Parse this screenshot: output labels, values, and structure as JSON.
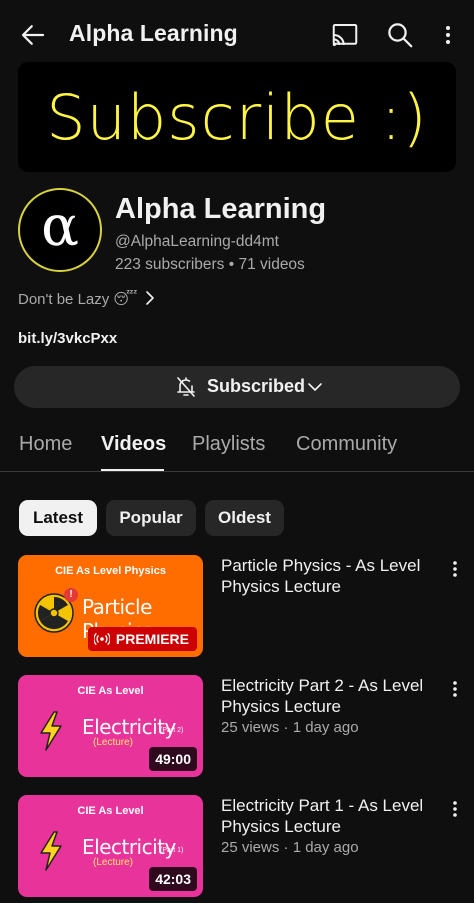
{
  "header": {
    "title": "Alpha Learning",
    "icons": {
      "back": "back-arrow-icon",
      "cast": "cast-icon",
      "search": "search-icon",
      "more": "more-vert-icon"
    }
  },
  "banner": {
    "text": "Subscribe :)"
  },
  "channel": {
    "avatar_letter": "α",
    "name": "Alpha Learning",
    "handle": "@AlphaLearning-dd4mt",
    "stats": "223 subscribers • 71 videos",
    "description": "Don't be Lazy 😴",
    "link": "bit.ly/3vkcPxx"
  },
  "subscribe": {
    "label": "Subscribed"
  },
  "tabs": [
    {
      "label": "Home",
      "active": false
    },
    {
      "label": "Videos",
      "active": true
    },
    {
      "label": "Playlists",
      "active": false
    },
    {
      "label": "Community",
      "active": false
    }
  ],
  "filters": [
    {
      "label": "Latest",
      "selected": true
    },
    {
      "label": "Popular",
      "selected": false
    },
    {
      "label": "Oldest",
      "selected": false
    }
  ],
  "videos": [
    {
      "title": "Particle Physics - As Level Physics Lecture",
      "meta": "",
      "thumb": {
        "kicker": "CIE As Level Physics",
        "big": "Particle Physics",
        "sub": "(Lecture)",
        "badge": "PREMIERE",
        "alert": "!",
        "color": "#ff6c00"
      }
    },
    {
      "title": "Electricity Part 2 - As Level Physics Lecture",
      "meta": "25 views · 1 day ago",
      "thumb": {
        "kicker": "CIE As Level",
        "big": "Electricity",
        "sub": "(Lecture)",
        "part": "(Part 2)",
        "duration": "49:00",
        "color": "#e8349a"
      }
    },
    {
      "title": "Electricity Part 1 - As Level Physics Lecture",
      "meta": "25 views · 1 day ago",
      "thumb": {
        "kicker": "CIE As Level",
        "big": "Electricity",
        "sub": "(Lecture)",
        "part": "(Part 1)",
        "duration": "42:03",
        "color": "#e8349a"
      }
    }
  ]
}
